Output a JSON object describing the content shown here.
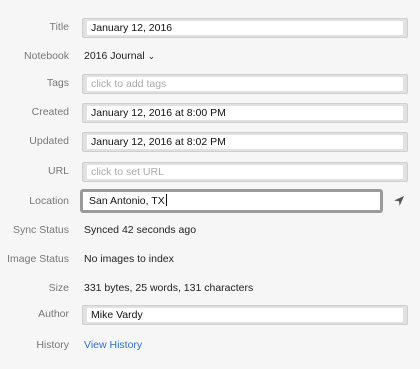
{
  "fields": {
    "title": {
      "label": "Title",
      "value": "January 12, 2016"
    },
    "notebook": {
      "label": "Notebook",
      "value": "2016 Journal",
      "chevron": "⌄"
    },
    "tags": {
      "label": "Tags",
      "placeholder": "click to add tags"
    },
    "created": {
      "label": "Created",
      "value": "January 12, 2016 at 8:00 PM"
    },
    "updated": {
      "label": "Updated",
      "value": "January 12, 2016 at 8:02 PM"
    },
    "url": {
      "label": "URL",
      "placeholder": "click to set URL"
    },
    "location": {
      "label": "Location",
      "value": "San Antonio, TX",
      "icon": "location-arrow-icon"
    },
    "sync_status": {
      "label": "Sync Status",
      "value": "Synced 42 seconds ago"
    },
    "image_status": {
      "label": "Image Status",
      "value": "No images to index"
    },
    "size": {
      "label": "Size",
      "value": "331 bytes, 25 words, 131 characters"
    },
    "author": {
      "label": "Author",
      "value": "Mike Vardy"
    },
    "history": {
      "label": "History",
      "link": "View History"
    }
  },
  "colors": {
    "link": "#2f6fc8",
    "label": "#777777",
    "background": "#f6f6f6"
  }
}
